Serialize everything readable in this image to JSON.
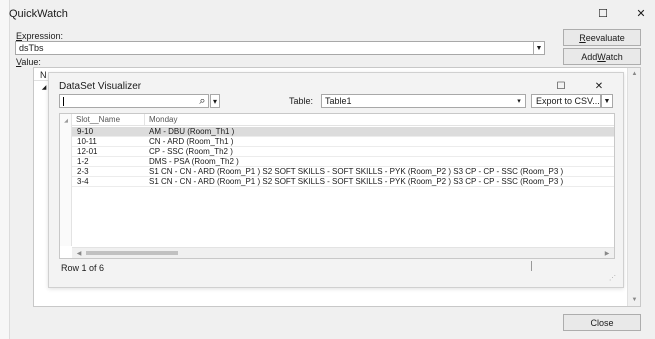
{
  "window": {
    "title": "QuickWatch",
    "buttons": {
      "maximize": "☐",
      "close": "✕"
    }
  },
  "expression": {
    "label_accel": "E",
    "label_rest": "xpression:",
    "value": "dsTbs",
    "reevaluate_accel": "R",
    "reevaluate_rest": "eevaluate",
    "add_watch_pre": "Add ",
    "add_watch_accel": "W",
    "add_watch_post": "atch"
  },
  "value": {
    "label_accel": "V",
    "label_rest": "alue:",
    "col_header_stub": "N"
  },
  "visualizer": {
    "title": "DataSet Visualizer",
    "buttons": {
      "maximize": "☐",
      "close": "✕"
    },
    "search": {
      "value": "",
      "icon_glyph": "⌕",
      "dropdown_glyph": "▾"
    },
    "table_label": "Table:",
    "table_value": "Table1",
    "export_label": "Export to CSV...",
    "columns": [
      "Slot__Name",
      "Monday"
    ],
    "rows": [
      [
        "9-10",
        "AM - DBU (Room_Th1 )"
      ],
      [
        "10-11",
        "CN - ARD (Room_Th1 )"
      ],
      [
        "12-01",
        "CP - SSC (Room_Th2 )"
      ],
      [
        "1-2",
        "DMS - PSA (Room_Th2 )"
      ],
      [
        "2-3",
        "S1 CN - CN - ARD (Room_P1 ) S2 SOFT SKILLS - SOFT SKILLS - PYK (Room_P2 ) S3 CP - CP - SSC (Room_P3 )"
      ],
      [
        "3-4",
        "S1 CN - CN - ARD (Room_P1 ) S2 SOFT SKILLS - SOFT SKILLS - PYK (Room_P2 ) S3 CP - CP - SSC (Room_P3 )"
      ]
    ],
    "status": "Row 1 of 6"
  },
  "footer": {
    "close_label": "Close"
  },
  "colors": {
    "accent": "#0078d7",
    "selected_row": "#dcdcdc",
    "dialog_bg": "#f0f0f0"
  }
}
